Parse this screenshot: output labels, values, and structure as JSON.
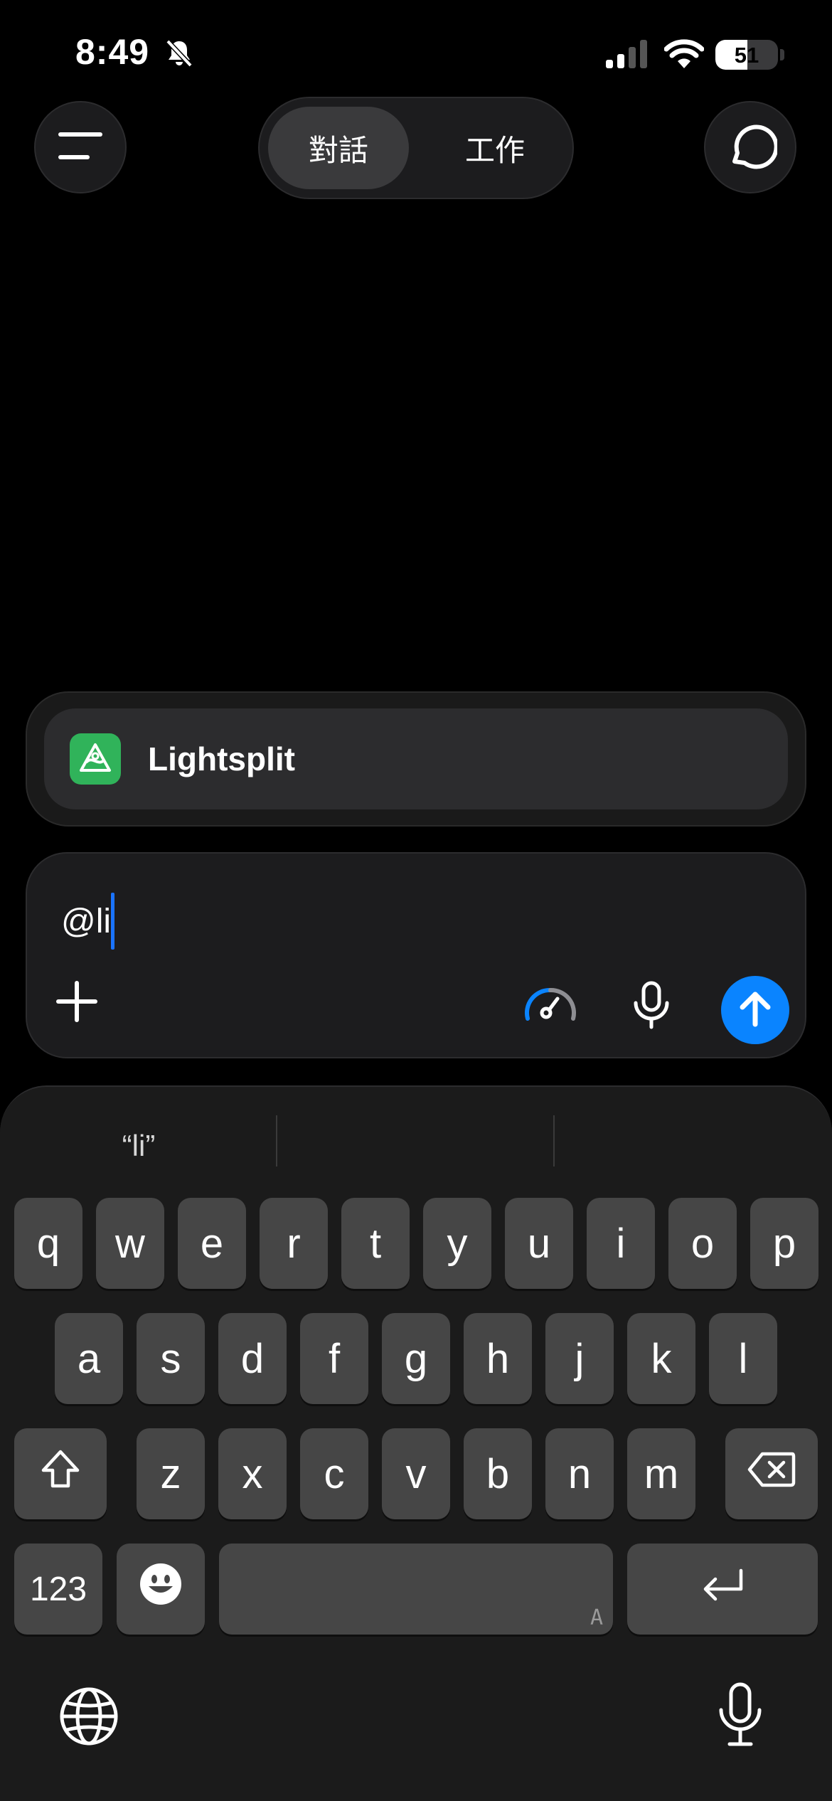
{
  "status_bar": {
    "time": "8:49",
    "battery_level": "51",
    "battery_fraction": 0.51,
    "icons": [
      "bell-slash-icon",
      "cellular-signal-icon",
      "wifi-icon",
      "battery-icon"
    ]
  },
  "nav": {
    "menu_icon": "menu-icon",
    "new_chat_icon": "new-chat-icon",
    "segments": [
      {
        "label": "對話",
        "selected": true
      },
      {
        "label": "工作",
        "selected": false
      }
    ]
  },
  "suggestion": {
    "app_name": "Lightsplit",
    "app_icon": "lightsplit-app-icon",
    "icon_color": "#30b35a"
  },
  "composer": {
    "input_value": "@li",
    "caret_color": "#1a73ff",
    "send_color": "#0a84ff",
    "icons": [
      "plus-icon",
      "speed-gauge-icon",
      "microphone-icon",
      "send-arrow-icon"
    ]
  },
  "keyboard": {
    "predictions": [
      "“li”",
      "",
      ""
    ],
    "row1": [
      "q",
      "w",
      "e",
      "r",
      "t",
      "y",
      "u",
      "i",
      "o",
      "p"
    ],
    "row2": [
      "a",
      "s",
      "d",
      "f",
      "g",
      "h",
      "j",
      "k",
      "l"
    ],
    "row3": [
      "z",
      "x",
      "c",
      "v",
      "b",
      "n",
      "m"
    ],
    "numbers_key": "123",
    "space_hint": "A",
    "icons": [
      "shift-icon",
      "backspace-icon",
      "emoji-icon",
      "return-icon",
      "globe-icon",
      "dictation-mic-icon"
    ]
  }
}
